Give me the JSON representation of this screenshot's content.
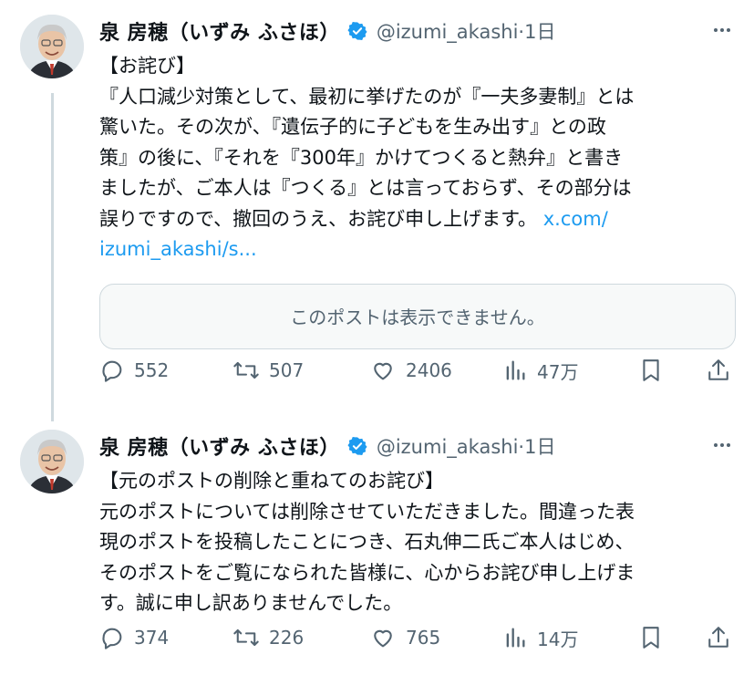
{
  "tweets": [
    {
      "author": {
        "name": "泉 房穂（いずみ ふさほ）",
        "handle": "@izumi_akashi",
        "separator": "·",
        "time": "1日"
      },
      "text_lines": [
        "【お詫び】",
        "『人口減少対策として、最初に挙げたのが『一夫多妻制』とは",
        "驚いた。その次が、『遺伝子的に子どもを生み出す』との政",
        "策』の後に、『それを『300年』かけてつくると熱弁』と書き",
        "ましたが、ご本人は『つくる』とは言っておらず、その部分は",
        "誤りですので、撤回のうえ、お詫び申し上げます。"
      ],
      "link_part1": "x.com/",
      "link_part2": "izumi_akashi/s...",
      "quote_card": "このポストは表示できません。",
      "stats": {
        "replies": "552",
        "reposts": "507",
        "likes": "2406",
        "views": "47万"
      }
    },
    {
      "author": {
        "name": "泉 房穂（いずみ ふさほ）",
        "handle": "@izumi_akashi",
        "separator": "·",
        "time": "1日"
      },
      "text_lines": [
        "【元のポストの削除と重ねてのお詫び】",
        "元のポストについては削除させていただきました。間違った表",
        "現のポストを投稿したことにつき、石丸伸二氏ご本人はじめ、",
        "そのポストをご覧になられた皆様に、心からお詫び申し上げま",
        "す。誠に申し訳ありませんでした。"
      ],
      "stats": {
        "replies": "374",
        "reposts": "226",
        "likes": "765",
        "views": "14万"
      }
    }
  ],
  "colors": {
    "verified": "#1d9bf0",
    "link": "#1d9bf0",
    "muted": "#536471",
    "text": "#0f1419",
    "thread_line": "#cfd9de"
  },
  "icons": [
    "verified-badge-icon",
    "more-icon",
    "reply-icon",
    "repost-icon",
    "like-icon",
    "views-icon",
    "bookmark-icon",
    "share-icon"
  ]
}
